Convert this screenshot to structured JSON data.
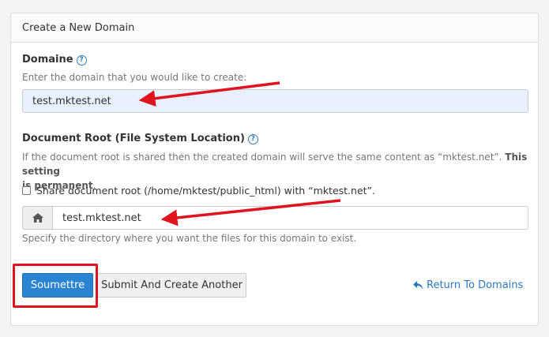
{
  "panel": {
    "title": "Create a New Domain"
  },
  "domain": {
    "label": "Domaine",
    "hint": "Enter the domain that you would like to create:",
    "value": "test.mktest.net"
  },
  "document_root": {
    "label": "Document Root (File System Location)",
    "hint_prefix": "If the document root is shared then the created domain will serve the same content as “mktest.net”.",
    "hint_strong_1": "This setting",
    "hint_strong_2": "is permanent",
    "hint_suffix": ".",
    "share_label": "Share document root (/home/mktest/public_html) with “mktest.net”.",
    "value": "test.mktest.net",
    "footnote": "Specify the directory where you want the files for this domain to exist."
  },
  "actions": {
    "submit_label": "Soumettre",
    "submit_another_label": "Submit And Create Another",
    "return_label": "Return To Domains"
  },
  "colors": {
    "annotation_red": "#e0141e",
    "primary_blue": "#2a84d2",
    "link_blue": "#2a7abf"
  }
}
